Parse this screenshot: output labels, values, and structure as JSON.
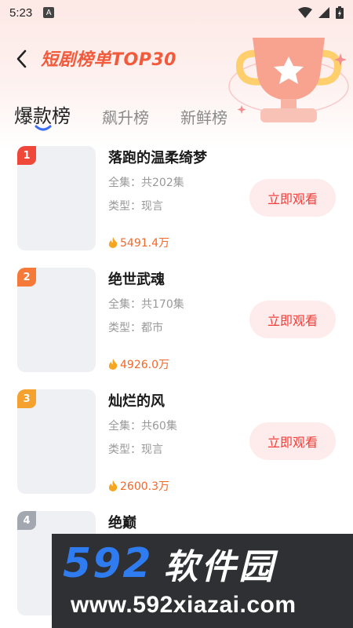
{
  "status_bar": {
    "time": "5:23",
    "notification_letter": "A",
    "icons": [
      "wifi-icon",
      "signal-icon",
      "battery-icon"
    ]
  },
  "header": {
    "back_icon": "chevron-left-icon",
    "title": "短剧榜单TOP30",
    "decoration": "trophy-icon",
    "accent_color": "#f25a3c"
  },
  "tabs": [
    {
      "label": "爆款榜",
      "active": true
    },
    {
      "label": "飙升榜",
      "active": false
    },
    {
      "label": "新鲜榜",
      "active": false
    }
  ],
  "items": [
    {
      "rank": "1",
      "rank_color": "#f0473b",
      "title": "落跑的温柔绮梦",
      "episodes": "全集：共202集",
      "genre": "类型：现言",
      "heat": "5491.4万",
      "button": "立即观看"
    },
    {
      "rank": "2",
      "rank_color": "#f57a3a",
      "title": "绝世武魂",
      "episodes": "全集：共170集",
      "genre": "类型：都市",
      "heat": "4926.0万",
      "button": "立即观看"
    },
    {
      "rank": "3",
      "rank_color": "#f5a12e",
      "title": "灿烂的风",
      "episodes": "全集：共60集",
      "genre": "类型：现言",
      "heat": "2600.3万",
      "button": "立即观看"
    },
    {
      "rank": "4",
      "rank_color": "#a3a7b0",
      "title": "绝巅",
      "episodes": "",
      "genre": "",
      "heat": "",
      "button": ""
    }
  ],
  "watermark": {
    "number": "592",
    "name": "软件园",
    "url": "www.592xiazai.com"
  }
}
